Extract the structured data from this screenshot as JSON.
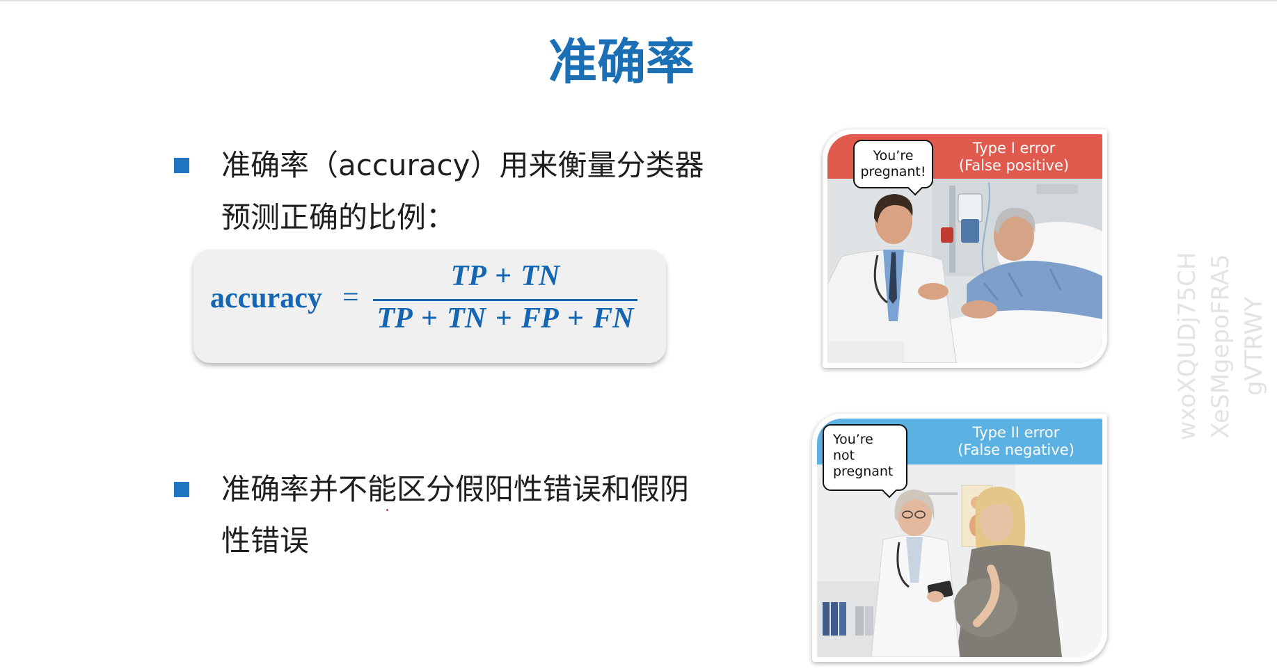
{
  "slide": {
    "title": "准确率",
    "bullets": [
      {
        "lines": [
          "准确率（accuracy）用来衡量分类器",
          "预测正确的比例："
        ]
      },
      {
        "lines": [
          "准确率并不能区分假阳性错误和假阴",
          "性错误"
        ]
      }
    ],
    "formula": {
      "lhs": "accuracy",
      "equals": "=",
      "numerator": "TP + TN",
      "denominator": "TP + TN + FP + FN"
    },
    "images": [
      {
        "header_line1": "Type I error",
        "header_line2": "(False positive)",
        "bubble_lines": [
          "You’re",
          "pregnant!"
        ]
      },
      {
        "header_line1": "Type II error",
        "header_line2": "(False negative)",
        "bubble_lines": [
          "You’re",
          "not",
          "pregnant"
        ]
      }
    ],
    "watermark_lines": [
      "wxoXQUDj75CH",
      "XeSMgepoFRA5",
      "gVTRWY"
    ]
  },
  "colors": {
    "title": "#1b6fb5",
    "bullet": "#1f75c0",
    "formula": "#1466b3",
    "type1_header": "#e05a4e",
    "type2_header": "#5bb2e2",
    "watermark": "#e3e3e3"
  }
}
